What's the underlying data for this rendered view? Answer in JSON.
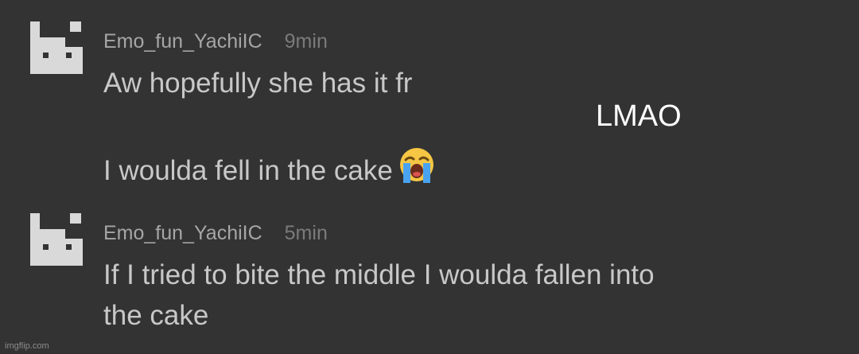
{
  "comments": [
    {
      "avatar_icon": "pixel-creature-avatar",
      "username": "Emo_fun_YachiIC",
      "time": "9min",
      "lines": [
        "Aw hopefully she has it fr",
        "",
        "I woulda fell in the cake"
      ],
      "emoji": "loudly-crying-face"
    },
    {
      "avatar_icon": "pixel-creature-avatar",
      "username": "Emo_fun_YachiIC",
      "time": "5min",
      "lines": [
        "If I tried to bite the middle I woulda fallen into",
        "the cake"
      ]
    }
  ],
  "overlay_text": "LMAO",
  "watermark": "imgflip.com",
  "colors": {
    "background": "#333333",
    "avatar": "#d9d9d9",
    "username": "#a6a6a6",
    "time": "#7b7b7b",
    "message": "#c8c8c8",
    "overlay": "#ffffff"
  }
}
